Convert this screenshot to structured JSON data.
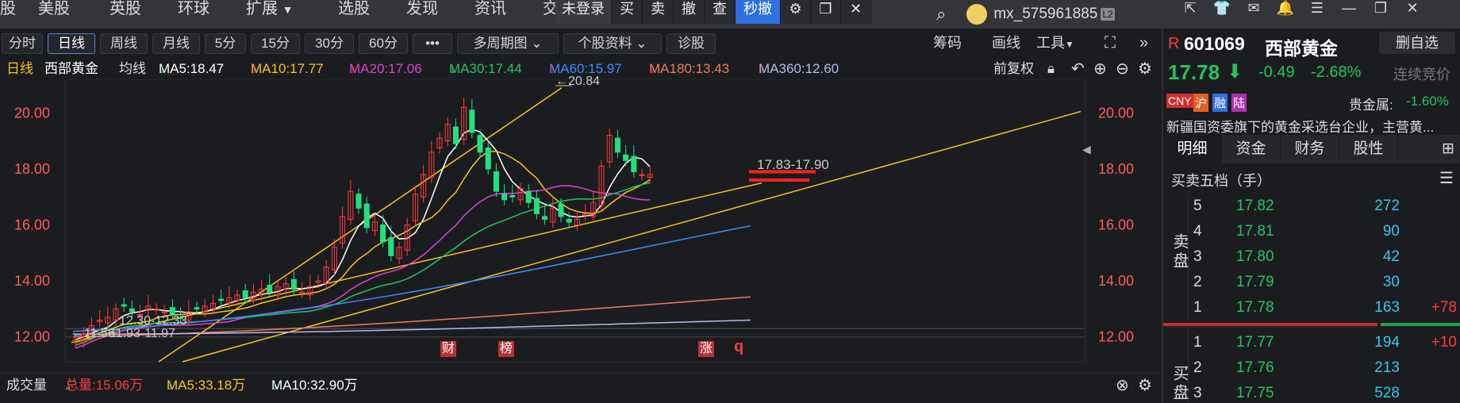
{
  "menu": {
    "items": [
      "股",
      "美股",
      "英股",
      "环球",
      "扩展",
      "选股",
      "发现",
      "资讯",
      "交"
    ],
    "expand_label": "扩展"
  },
  "trade_ops": [
    "未登录",
    "买",
    "卖",
    "撤",
    "查",
    "秒撤"
  ],
  "user": {
    "name": "mx_575961885",
    "level": "L2"
  },
  "periods": [
    "分时",
    "日线",
    "周线",
    "月线",
    "5分",
    "15分",
    "30分",
    "60分",
    "•••",
    "多周期图",
    "个股资料",
    "诊股"
  ],
  "toolbar_right": [
    "筹码",
    "画线",
    "工具"
  ],
  "ma_line": {
    "period_label": "日线",
    "stock_name": "西部黄金",
    "avg_label": "均线",
    "items": [
      {
        "label": "MA5:18.47",
        "arrow": "↓",
        "color": "#ffffff",
        "arrow_color": "#22c55e"
      },
      {
        "label": "MA10:17.77",
        "arrow": "↑",
        "color": "#f5c518",
        "arrow_color": "#ff3b3b"
      },
      {
        "label": "MA20:17.06",
        "arrow": "↑",
        "color": "#e040d0",
        "arrow_color": "#ff3b3b"
      },
      {
        "label": "MA30:17.44",
        "arrow": "↓",
        "color": "#22c55e",
        "arrow_color": "#22c55e"
      },
      {
        "label": "MA60:15.97",
        "arrow": "↑",
        "color": "#3b8bff",
        "arrow_color": "#ff3b3b"
      },
      {
        "label": "MA180:13.43",
        "arrow": "↑",
        "color": "#f07a5a",
        "arrow_color": "#ff3b3b"
      },
      {
        "label": "MA360:12.60",
        "arrow": "↑",
        "color": "#b8b8f0",
        "arrow_color": "#ff3b3b"
      }
    ],
    "adjust_label": "前复权"
  },
  "chart_data": {
    "type": "candlestick",
    "y_ticks_left": [
      "20.00",
      "18.00",
      "16.00",
      "14.00",
      "12.00"
    ],
    "y_ticks_right": [
      "20.00",
      "18.00",
      "16.00",
      "14.00",
      "12.00"
    ],
    "ylim": [
      11.0,
      21.2
    ],
    "annotations": {
      "high": "←20.84",
      "low": "←11.56",
      "range1": "12.30-12.33",
      "range2": "11.93-11.97",
      "current_range": "17.83-17.90"
    },
    "event_markers": [
      "财",
      "榜",
      "涨"
    ],
    "q_mark": "q"
  },
  "volume": {
    "label": "成交量",
    "total": "总量:15.06万",
    "total_arrow": "↓",
    "ma5": "MA5:33.18万",
    "ma5_arrow": "↓",
    "ma10": "MA10:32.90万",
    "ma10_arrow": "↓"
  },
  "quote": {
    "code": "601069",
    "name": "西部黄金",
    "prefix": "R",
    "remove_watch": "删自选",
    "price": "17.78",
    "change": "-0.49",
    "change_pct": "-2.68%",
    "streak_label": "连续竞价",
    "tags": [
      "CNY",
      "沪",
      "融",
      "陆"
    ],
    "sector": "贵金属:",
    "sector_change": "-1.60%",
    "description": "新疆国资委旗下的黄金采选台企业，主营黄...",
    "tabs": [
      "明细",
      "资金",
      "财务",
      "股性"
    ],
    "orderbook_title": "买卖五档（手）",
    "sell_label": "卖盘",
    "buy_label": "买盘",
    "asks": [
      {
        "level": "5",
        "price": "17.82",
        "vol": "272",
        "delta": ""
      },
      {
        "level": "4",
        "price": "17.81",
        "vol": "90",
        "delta": ""
      },
      {
        "level": "3",
        "price": "17.80",
        "vol": "42",
        "delta": ""
      },
      {
        "level": "2",
        "price": "17.79",
        "vol": "30",
        "delta": ""
      },
      {
        "level": "1",
        "price": "17.78",
        "vol": "163",
        "delta": "+78"
      }
    ],
    "bids": [
      {
        "level": "1",
        "price": "17.77",
        "vol": "194",
        "delta": "+10"
      },
      {
        "level": "2",
        "price": "17.76",
        "vol": "213",
        "delta": ""
      },
      {
        "level": "3",
        "price": "17.75",
        "vol": "528",
        "delta": ""
      }
    ]
  }
}
